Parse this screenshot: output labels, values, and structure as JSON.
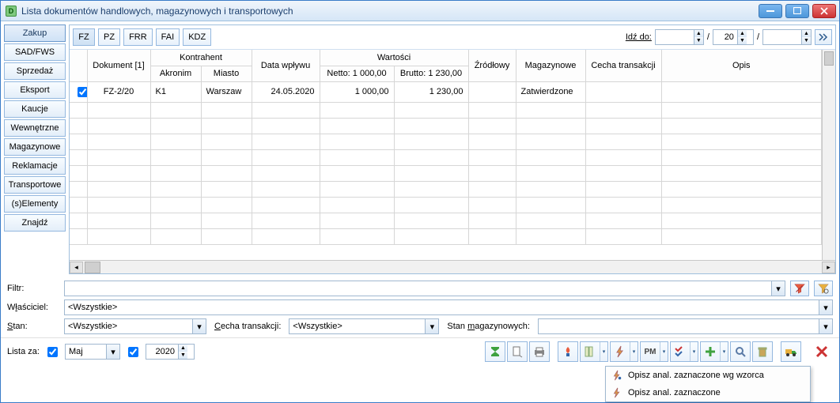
{
  "window": {
    "title": "Lista dokumentów handlowych, magazynowych i transportowych"
  },
  "sidebar": [
    "Zakup",
    "SAD/FWS",
    "Sprzedaż",
    "Eksport",
    "Kaucje",
    "Wewnętrzne",
    "Magazynowe",
    "Reklamacje",
    "Transportowe",
    "(s)Elementy",
    "Znajdź"
  ],
  "sidebar_active": 0,
  "doctypes": [
    "FZ",
    "PZ",
    "FRR",
    "FAI",
    "KDZ"
  ],
  "doctypes_active": 0,
  "goto": {
    "label": "Idź do:",
    "val1": "",
    "val2": "20",
    "val3": ""
  },
  "grid": {
    "headers": {
      "dokument": "Dokument [1]",
      "kontrahent": "Kontrahent",
      "akronim": "Akronim",
      "miasto": "Miasto",
      "wplyw": "Data wpływu",
      "wartosci": "Wartości",
      "netto": "Netto: 1 000,00",
      "brutto": "Brutto: 1 230,00",
      "zrodlowy": "Źródłowy",
      "magazynowe": "Magazynowe",
      "cecha": "Cecha transakcji",
      "opis": "Opis"
    },
    "rows": [
      {
        "checked": true,
        "dok": "FZ-2/20",
        "akr": "K1",
        "miasto": "Warszaw",
        "data": "24.05.2020",
        "netto": "1 000,00",
        "brutto": "1 230,00",
        "zrd": "",
        "mag": "Zatwierdzone",
        "cecha": "",
        "opis": ""
      }
    ]
  },
  "filters": {
    "filtr_label": "Filtr:",
    "wlasciciel_label_pre": "W",
    "wlasciciel_label_u": "ł",
    "wlasciciel_label_post": "aściciel:",
    "wlasciciel_val": "<Wszystkie>",
    "stan_label_pre": "",
    "stan_label_u": "S",
    "stan_label_post": "tan:",
    "stan_val": "<Wszystkie>",
    "cecha_label_pre": "",
    "cecha_label_u": "C",
    "cecha_label_post": "echa transakcji:",
    "cecha_val": "<Wszystkie>",
    "stanmag_label_pre": "Stan ",
    "stanmag_label_u": "m",
    "stanmag_label_post": "agazynowych:",
    "stanmag_val": ""
  },
  "listza": {
    "label": "Lista za:",
    "month": "Maj",
    "year": "2020",
    "month_checked": true,
    "year_checked": true
  },
  "popup": {
    "items": [
      "Opisz anal. zaznaczone wg wzorca",
      "Opisz anal. zaznaczone"
    ]
  }
}
